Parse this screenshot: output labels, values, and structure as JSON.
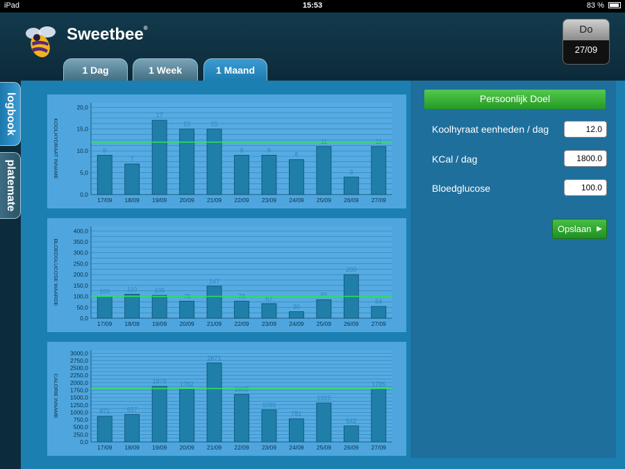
{
  "status_bar": {
    "device": "iPad",
    "time": "15:53",
    "battery": "83 %"
  },
  "header": {
    "app_title": "Sweetbee",
    "registered": "®",
    "day": "Do",
    "date": "27/09"
  },
  "tabs": [
    {
      "label": "1 Dag"
    },
    {
      "label": "1 Week"
    },
    {
      "label": "1 Maand"
    }
  ],
  "side_tabs": [
    {
      "label": "logbook"
    },
    {
      "label": "platemate"
    }
  ],
  "chart_data": [
    {
      "type": "bar",
      "ylabel": "KOOLHYDRAAT INNAME",
      "categories": [
        "17/09",
        "18/09",
        "19/09",
        "20/09",
        "21/09",
        "22/09",
        "23/09",
        "24/09",
        "25/09",
        "26/09",
        "27/09"
      ],
      "values": [
        9,
        7,
        17,
        15,
        15,
        9,
        9,
        8,
        11,
        4,
        11
      ],
      "value_labels": [
        "9",
        "7",
        "17",
        "15",
        "15",
        "9",
        "9",
        "8",
        "11",
        "3",
        "11"
      ],
      "yticks": [
        "0,0",
        "5,0",
        "10,0",
        "15,0",
        "20,0"
      ],
      "ylim": [
        0,
        21
      ],
      "target": 12,
      "grid_step": 1.25
    },
    {
      "type": "bar",
      "ylabel": "BLOEDGLUCOSE WAARDE",
      "categories": [
        "17/09",
        "18/09",
        "19/09",
        "20/09",
        "21/09",
        "22/09",
        "23/09",
        "24/09",
        "25/09",
        "26/09",
        "27/09"
      ],
      "values": [
        100,
        110,
        105,
        78,
        147,
        78,
        67,
        30,
        85,
        200,
        54
      ],
      "value_labels": [
        "100",
        "110",
        "105",
        "78",
        "147",
        "78",
        "67",
        "30",
        "85",
        "200",
        "54"
      ],
      "yticks": [
        "0,0",
        "50,0",
        "100,0",
        "150,0",
        "200,0",
        "250,0",
        "300,0",
        "350,0",
        "400,0"
      ],
      "ylim": [
        0,
        420
      ],
      "target": 100,
      "grid_step": 25
    },
    {
      "type": "bar",
      "ylabel": "CALORIE INNAME",
      "categories": [
        "17/09",
        "18/09",
        "19/09",
        "20/09",
        "21/09",
        "22/09",
        "23/09",
        "24/09",
        "25/09",
        "26/09",
        "27/09"
      ],
      "values": [
        871,
        927,
        1879,
        1782,
        2671,
        1605,
        1086,
        781,
        1315,
        542,
        1785
      ],
      "value_labels": [
        "871",
        "927",
        "1879",
        "1782",
        "2671",
        "1605",
        "1086",
        "781",
        "1315",
        "542",
        "1785"
      ],
      "yticks": [
        "0,0",
        "250,0",
        "500,0",
        "750,0",
        "1000,0",
        "1250,0",
        "1500,0",
        "1750,0",
        "2000,0",
        "2250,0",
        "2500,0",
        "2750,0",
        "3000,0"
      ],
      "ylim": [
        0,
        3100
      ],
      "target": 1800,
      "grid_step": 125
    }
  ],
  "goal": {
    "title": "Persoonlijk Doel",
    "fields": [
      {
        "label": "Koolhyraat eenheden / dag",
        "value": "12.0"
      },
      {
        "label": "KCal / dag",
        "value": "1800.0"
      },
      {
        "label": "Bloedglucose",
        "value": "100.0"
      }
    ],
    "save_label": "Opslaan"
  },
  "colors": {
    "background": "#1b7fb1",
    "panel": "#4fa6de",
    "bar": "#1f7fa8",
    "target_line": "#2ee05a",
    "save_button": "#2fa82f"
  }
}
